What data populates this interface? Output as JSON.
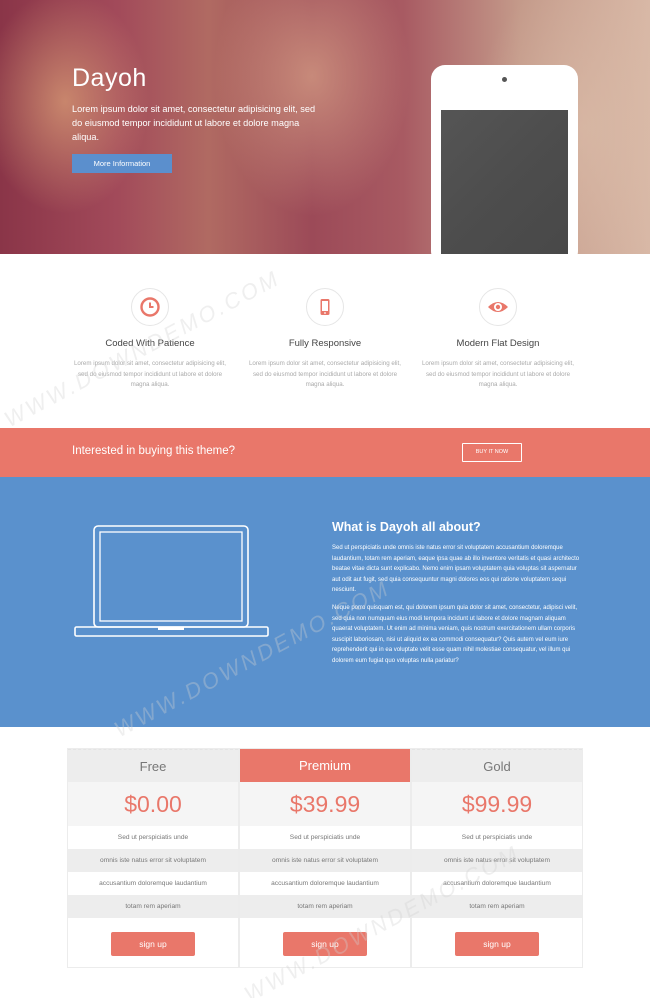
{
  "hero": {
    "title": "Dayoh",
    "text": "Lorem ipsum dolor sit amet, consectetur adipisicing elit, sed do eiusmod tempor incididunt ut labore et dolore magna aliqua.",
    "button": "More Information"
  },
  "features": [
    {
      "icon": "clock-icon",
      "title": "Coded With Patience",
      "text": "Lorem ipsum dolor sit amet, consectetur adipisicing elit, sed do eiusmod tempor incididunt ut labore et dolore magna aliqua."
    },
    {
      "icon": "mobile-phone-icon",
      "title": "Fully Responsive",
      "text": "Lorem ipsum dolor sit amet, consectetur adipisicing elit, sed do eiusmod tempor incididunt ut labore et dolore magna aliqua."
    },
    {
      "icon": "eye-icon",
      "title": "Modern Flat Design",
      "text": "Lorem ipsum dolor sit amet, consectetur adipisicing elit, sed do eiusmod tempor incididunt ut labore et dolore magna aliqua."
    }
  ],
  "cta": {
    "text": "Interested in buying this theme?",
    "button": "BUY IT NOW"
  },
  "about": {
    "title": "What is Dayoh all about?",
    "p1": "Sed ut perspiciatis unde omnis iste natus error sit voluptatem accusantium doloremque laudantium, totam rem aperiam, eaque ipsa quae ab illo inventore veritatis et quasi architecto beatae vitae dicta sunt explicabo. Nemo enim ipsam voluptatem quia voluptas sit aspernatur aut odit aut fugit, sed quia consequuntur magni dolores eos qui ratione voluptatem sequi nesciunt.",
    "p2": "Neque porro quisquam est, qui dolorem ipsum quia dolor sit amet, consectetur, adipisci velit, sed quia non numquam eius modi tempora incidunt ut labore et dolore magnam aliquam quaerat voluptatem. Ut enim ad minima veniam, quis nostrum exercitationem ullam corporis suscipit laboriosam, nisi ut aliquid ex ea commodi consequatur? Quis autem vel eum iure reprehenderit qui in ea voluptate velit esse quam nihil molestiae consequatur, vel illum qui dolorem eum fugiat quo voluptas nulla pariatur?"
  },
  "pricing": [
    {
      "name": "Free",
      "price": "$0.00",
      "featured": false,
      "rows": [
        "Sed ut perspiciatis unde",
        "omnis iste natus error sit voluptatem",
        "accusantium doloremque laudantium",
        "totam rem aperiam"
      ],
      "button": "sign up"
    },
    {
      "name": "Premium",
      "price": "$39.99",
      "featured": true,
      "rows": [
        "Sed ut perspiciatis unde",
        "omnis iste natus error sit voluptatem",
        "accusantium doloremque laudantium",
        "totam rem aperiam"
      ],
      "button": "sign up"
    },
    {
      "name": "Gold",
      "price": "$99.99",
      "featured": false,
      "rows": [
        "Sed ut perspiciatis unde",
        "omnis iste natus error sit voluptatem",
        "accusantium doloremque laudantium",
        "totam rem aperiam"
      ],
      "button": "sign up"
    }
  ],
  "watermark": "WWW.DOWNDEMO.COM",
  "colors": {
    "accent": "#e9776a",
    "blue": "#5a91cd",
    "button_blue": "#5b8fcd"
  }
}
